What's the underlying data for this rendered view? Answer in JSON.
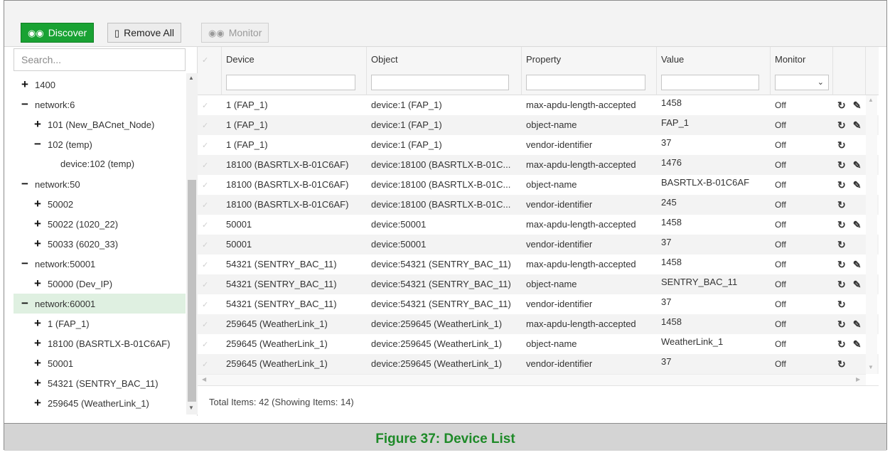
{
  "toolbar": {
    "discover_label": "Discover",
    "remove_label": "Remove All",
    "monitor_label": "Monitor",
    "discover_icon": "binoculars-icon",
    "remove_icon": "trash-icon",
    "monitor_icon": "binoculars-icon",
    "accent_color": "#19a233"
  },
  "tree": {
    "search_placeholder": "Search...",
    "nodes": [
      {
        "level": 0,
        "toggle": "+",
        "label": "1400"
      },
      {
        "level": 0,
        "toggle": "−",
        "label": "network:6"
      },
      {
        "level": 1,
        "toggle": "+",
        "label": "101 (New_BACnet_Node)"
      },
      {
        "level": 1,
        "toggle": "−",
        "label": "102 (temp)"
      },
      {
        "level": 2,
        "toggle": "",
        "label": "device:102 (temp)"
      },
      {
        "level": 0,
        "toggle": "−",
        "label": "network:50"
      },
      {
        "level": 1,
        "toggle": "+",
        "label": "50002"
      },
      {
        "level": 1,
        "toggle": "+",
        "label": "50022 (1020_22)"
      },
      {
        "level": 1,
        "toggle": "+",
        "label": "50033 (6020_33)"
      },
      {
        "level": 0,
        "toggle": "−",
        "label": "network:50001"
      },
      {
        "level": 1,
        "toggle": "+",
        "label": "50000 (Dev_IP)"
      },
      {
        "level": 0,
        "toggle": "−",
        "label": "network:60001",
        "selected": true
      },
      {
        "level": 1,
        "toggle": "+",
        "label": "1 (FAP_1)"
      },
      {
        "level": 1,
        "toggle": "+",
        "label": "18100 (BASRTLX-B-01C6AF)"
      },
      {
        "level": 1,
        "toggle": "+",
        "label": "50001"
      },
      {
        "level": 1,
        "toggle": "+",
        "label": "54321 (SENTRY_BAC_11)"
      },
      {
        "level": 1,
        "toggle": "+",
        "label": "259645 (WeatherLink_1)"
      }
    ]
  },
  "grid": {
    "columns": {
      "device": "Device",
      "object": "Object",
      "property": "Property",
      "value": "Value",
      "monitor": "Monitor"
    },
    "rows": [
      {
        "device": "1 (FAP_1)",
        "object": "device:1 (FAP_1)",
        "property": "max-apdu-length-accepted",
        "value": "1458",
        "monitor": "Off",
        "editable": true
      },
      {
        "device": "1 (FAP_1)",
        "object": "device:1 (FAP_1)",
        "property": "object-name",
        "value": "FAP_1",
        "monitor": "Off",
        "editable": true
      },
      {
        "device": "1 (FAP_1)",
        "object": "device:1 (FAP_1)",
        "property": "vendor-identifier",
        "value": "37",
        "monitor": "Off",
        "editable": false
      },
      {
        "device": "18100 (BASRTLX-B-01C6AF)",
        "object": "device:18100 (BASRTLX-B-01C...",
        "property": "max-apdu-length-accepted",
        "value": "1476",
        "monitor": "Off",
        "editable": true
      },
      {
        "device": "18100 (BASRTLX-B-01C6AF)",
        "object": "device:18100 (BASRTLX-B-01C...",
        "property": "object-name",
        "value": "BASRTLX-B-01C6AF",
        "monitor": "Off",
        "editable": true
      },
      {
        "device": "18100 (BASRTLX-B-01C6AF)",
        "object": "device:18100 (BASRTLX-B-01C...",
        "property": "vendor-identifier",
        "value": "245",
        "monitor": "Off",
        "editable": false
      },
      {
        "device": "50001",
        "object": "device:50001",
        "property": "max-apdu-length-accepted",
        "value": "1458",
        "monitor": "Off",
        "editable": true
      },
      {
        "device": "50001",
        "object": "device:50001",
        "property": "vendor-identifier",
        "value": "37",
        "monitor": "Off",
        "editable": false
      },
      {
        "device": "54321 (SENTRY_BAC_11)",
        "object": "device:54321 (SENTRY_BAC_11)",
        "property": "max-apdu-length-accepted",
        "value": "1458",
        "monitor": "Off",
        "editable": true
      },
      {
        "device": "54321 (SENTRY_BAC_11)",
        "object": "device:54321 (SENTRY_BAC_11)",
        "property": "object-name",
        "value": "SENTRY_BAC_11",
        "monitor": "Off",
        "editable": true
      },
      {
        "device": "54321 (SENTRY_BAC_11)",
        "object": "device:54321 (SENTRY_BAC_11)",
        "property": "vendor-identifier",
        "value": "37",
        "monitor": "Off",
        "editable": false
      },
      {
        "device": "259645 (WeatherLink_1)",
        "object": "device:259645 (WeatherLink_1)",
        "property": "max-apdu-length-accepted",
        "value": "1458",
        "monitor": "Off",
        "editable": true
      },
      {
        "device": "259645 (WeatherLink_1)",
        "object": "device:259645 (WeatherLink_1)",
        "property": "object-name",
        "value": "WeatherLink_1",
        "monitor": "Off",
        "editable": true
      },
      {
        "device": "259645 (WeatherLink_1)",
        "object": "device:259645 (WeatherLink_1)",
        "property": "vendor-identifier",
        "value": "37",
        "monitor": "Off",
        "editable": false
      }
    ],
    "footer": "Total Items: 42 (Showing Items: 14)",
    "refresh_icon": "refresh-icon",
    "edit_icon": "pencil-icon"
  },
  "caption": "Figure 37: Device List"
}
